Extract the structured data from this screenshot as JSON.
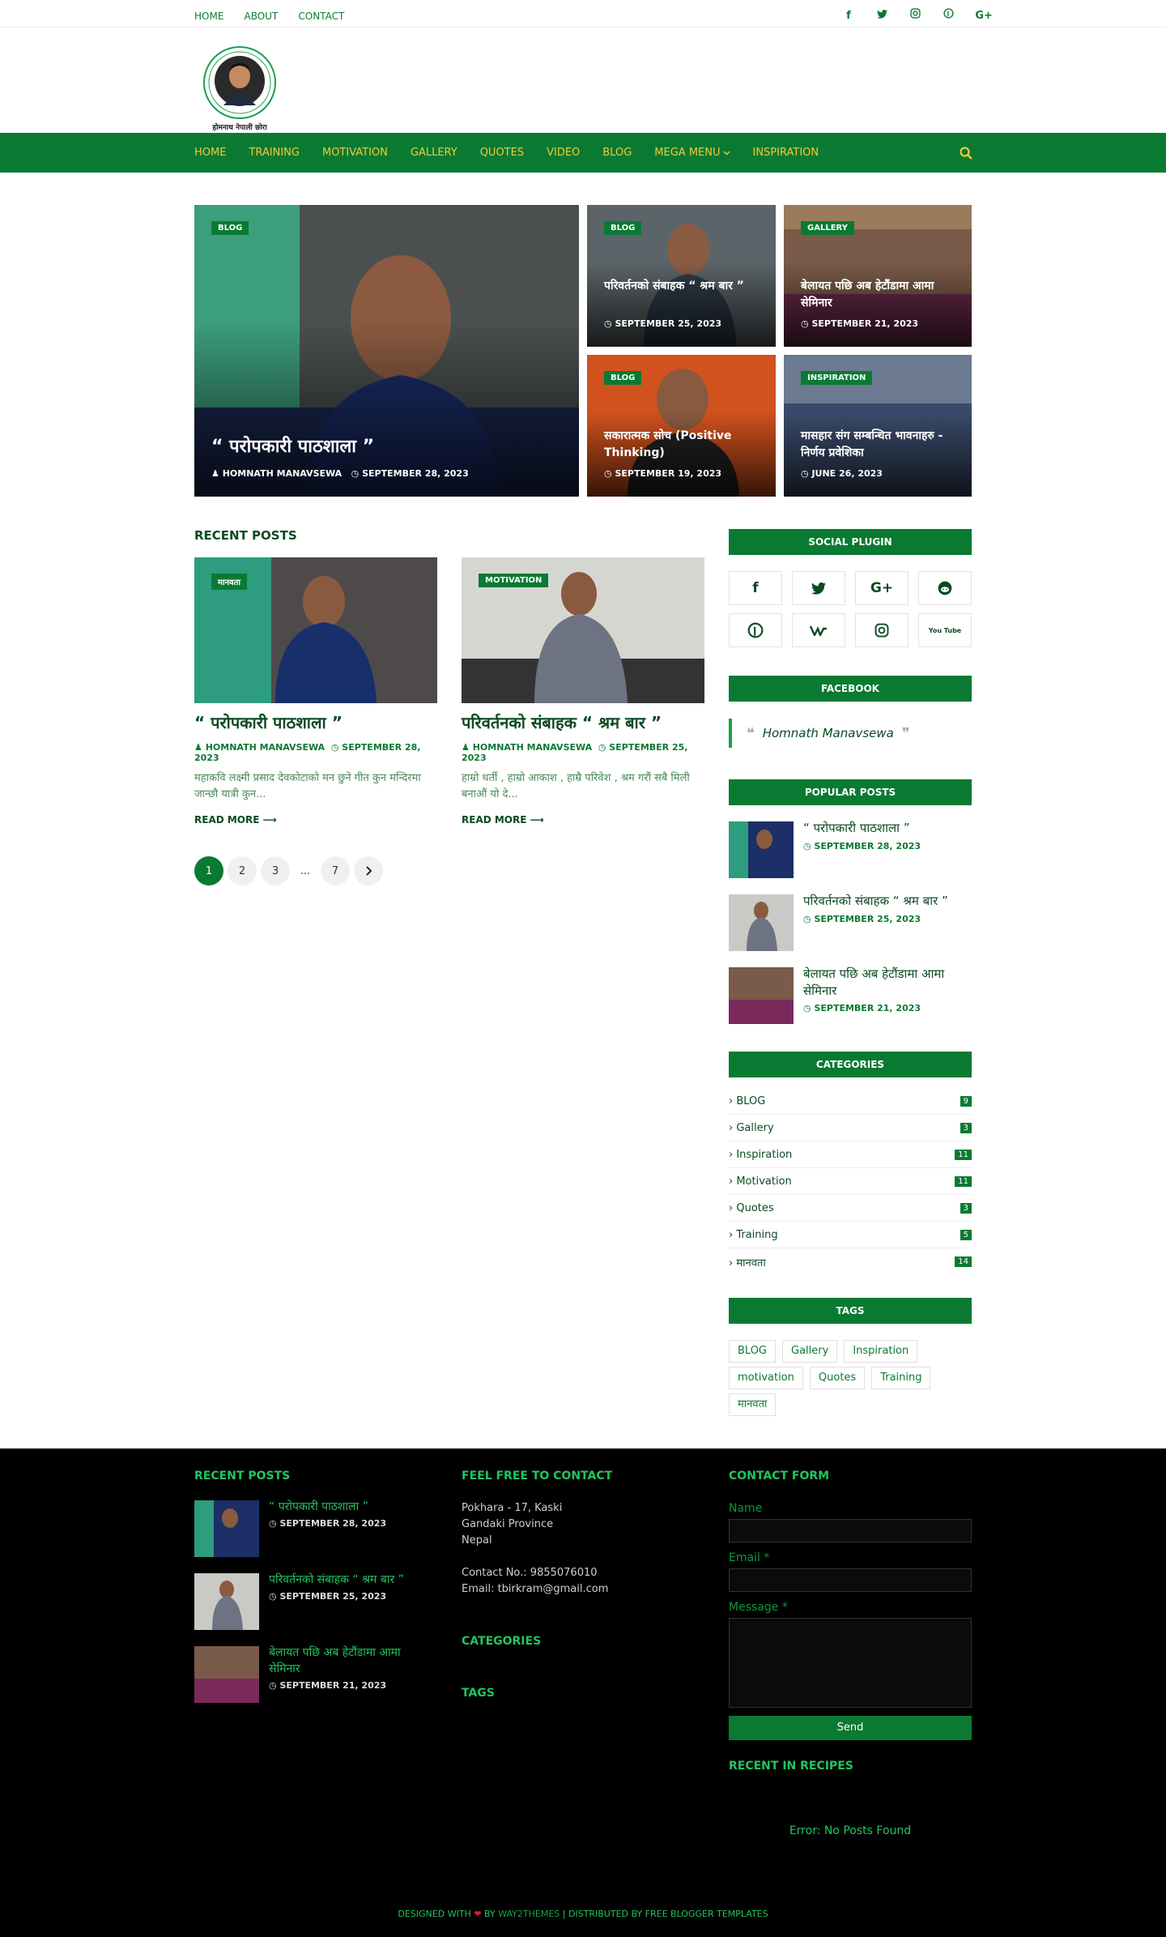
{
  "topbar": {
    "links": [
      "HOME",
      "ABOUT",
      "CONTACT"
    ],
    "social": [
      "f",
      "t",
      "ig",
      "p",
      "G+"
    ]
  },
  "logo": {
    "arc_text": "Homnath Manavsewa",
    "caption": "होमनाथ नेपाली छोरा"
  },
  "nav": {
    "items": [
      "HOME",
      "TRAINING",
      "MOTIVATION",
      "GALLERY",
      "QUOTES",
      "VIDEO",
      "BLOG",
      "MEGA MENU",
      "INSPIRATION"
    ]
  },
  "featured": {
    "main": {
      "label": "BLOG",
      "title": "“ परोपकारी पाठशाला ”",
      "author": "HOMNATH MANAVSEWA",
      "date": "SEPTEMBER 28, 2023"
    },
    "items": [
      {
        "label": "BLOG",
        "title": "परिवर्तनको संबाहक “ श्रम बार ”",
        "date": "SEPTEMBER 25, 2023"
      },
      {
        "label": "GALLERY",
        "title": "बेलायत पछि अब हेटौंडामा आमा सेमिनार",
        "date": "SEPTEMBER 21, 2023"
      },
      {
        "label": "BLOG",
        "title": "सकारात्मक सोच (Positive Thinking)",
        "date": "SEPTEMBER 19, 2023"
      },
      {
        "label": "INSPIRATION",
        "title": "मासहार संग सम्बन्धित भावनाहरु - निर्णय प्रवेशिका",
        "date": "JUNE 26, 2023"
      }
    ]
  },
  "recent": {
    "heading": "RECENT POSTS",
    "posts": [
      {
        "label": "मानवता",
        "title": "“ परोपकारी पाठशाला ”",
        "author": "HOMNATH MANAVSEWA",
        "date": "SEPTEMBER 28, 2023",
        "excerpt": "महाकवि लक्ष्मी प्रसाद देवकोटाको मन छुने गीत कुन मन्दिरमा जान्छौ यात्री कुन...",
        "more": "READ MORE"
      },
      {
        "label": "MOTIVATION",
        "title": "परिवर्तनको संबाहक “ श्रम बार ”",
        "author": "HOMNATH MANAVSEWA",
        "date": "SEPTEMBER 25, 2023",
        "excerpt": "हाम्रो धर्ती , हाम्रो आकाश , हाम्रै परिवेश , श्रम गरौं सबै मिली बनाऔं यो दे...",
        "more": "READ MORE"
      }
    ],
    "pages": [
      "1",
      "2",
      "3",
      "...",
      "7"
    ]
  },
  "sidebar": {
    "social_heading": "SOCIAL PLUGIN",
    "social": [
      "f",
      "t",
      "G+",
      "reddit",
      "p",
      "vk",
      "ig",
      "You Tube"
    ],
    "facebook_heading": "FACEBOOK",
    "facebook_name": "Homnath Manavsewa",
    "popular_heading": "POPULAR POSTS",
    "popular": [
      {
        "title": "“ परोपकारी पाठशाला ”",
        "date": "SEPTEMBER 28, 2023"
      },
      {
        "title": "परिवर्तनको संबाहक “ श्रम बार ”",
        "date": "SEPTEMBER 25, 2023"
      },
      {
        "title": "बेलायत पछि अब हेटौंडामा आमा सेमिनार",
        "date": "SEPTEMBER 21, 2023"
      }
    ],
    "categories_heading": "CATEGORIES",
    "categories": [
      {
        "name": "BLOG",
        "count": "9"
      },
      {
        "name": "Gallery",
        "count": "3"
      },
      {
        "name": "Inspiration",
        "count": "11"
      },
      {
        "name": "Motivation",
        "count": "11"
      },
      {
        "name": "Quotes",
        "count": "3"
      },
      {
        "name": "Training",
        "count": "5"
      },
      {
        "name": "मानवता",
        "count": "14"
      }
    ],
    "tags_heading": "TAGS",
    "tags": [
      "BLOG",
      "Gallery",
      "Inspiration",
      "motivation",
      "Quotes",
      "Training",
      "मानवता"
    ]
  },
  "footer": {
    "recent_heading": "RECENT POSTS",
    "recent": [
      {
        "title": "“ परोपकारी पाठशाला ”",
        "date": "SEPTEMBER 28, 2023"
      },
      {
        "title": "परिवर्तनको संबाहक “ श्रम बार ”",
        "date": "SEPTEMBER 25, 2023"
      },
      {
        "title": "बेलायत पछि अब हेटौंडामा आमा सेमिनार",
        "date": "SEPTEMBER 21, 2023"
      }
    ],
    "contact_heading": "FEEL FREE TO CONTACT",
    "address1": "Pokhara - 17, Kaski",
    "address2": "Gandaki Province",
    "address3": "Nepal",
    "phone": "Contact No.: 9855076010",
    "email": "Email: tbirkram@gmail.com",
    "categories_heading": "CATEGORIES",
    "tags_heading": "TAGS",
    "form_heading": "CONTACT FORM",
    "name_label": "Name",
    "email_label": "Email *",
    "message_label": "Message *",
    "send_label": "Send",
    "recipes_heading": "RECENT IN RECIPES",
    "error": "Error: No Posts Found",
    "credit_a": "DESIGNED WITH",
    "credit_by": "BY",
    "credit_brand": "WAY2THEMES",
    "credit_b": "| DISTRIBUTED BY FREE BLOGGER TEMPLATES"
  }
}
